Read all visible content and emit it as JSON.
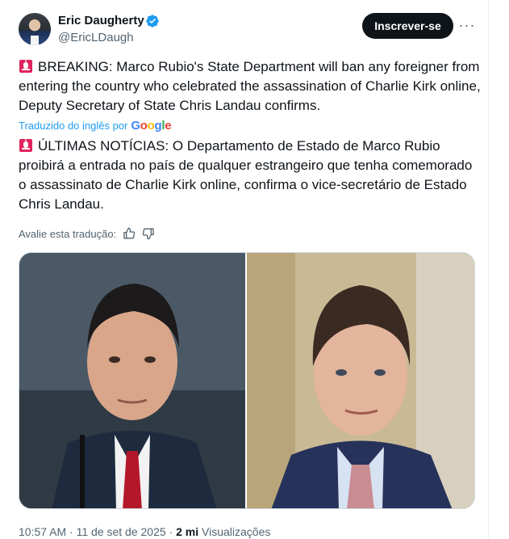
{
  "author": {
    "name": "Eric Daugherty",
    "handle": "@EricLDaugh",
    "verified": true
  },
  "follow_button_label": "Inscrever-se",
  "more_icon": "more-horizontal-icon",
  "post": {
    "original_text": "BREAKING: Marco Rubio's State Department will ban any foreigner from entering the country who celebrated the assassination of Charlie Kirk online, Deputy Secretary of State Chris Landau confirms.",
    "translated_label": "Traduzido do inglês por",
    "translation_provider": "Google",
    "translated_text": "ÚLTIMAS NOTÍCIAS: O Departamento de Estado de Marco Rubio proibirá a entrada no país de qualquer estrangeiro que tenha comemorado o assassinato de Charlie Kirk online, confirma o vice-secretário de Estado Chris Landau.",
    "rate_translation_label": "Avalie esta tradução:",
    "siren_icon": "police-siren-emoji-icon"
  },
  "meta": {
    "time": "10:57 AM",
    "separator": "·",
    "date": "11 de set de 2025",
    "views_count": "2 mi",
    "views_label": "Visualizações"
  },
  "colors": {
    "accent": "#1d9bf0",
    "text": "#0f1419",
    "muted": "#536471",
    "button_bg": "#0f1419",
    "siren_red": "#e0245e"
  }
}
